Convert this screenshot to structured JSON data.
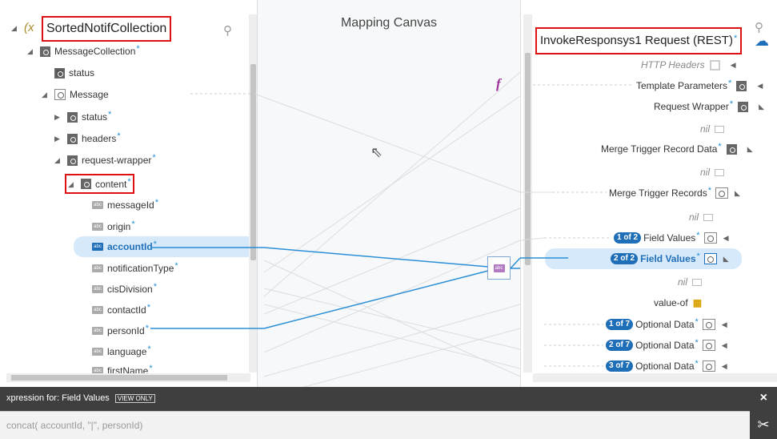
{
  "source": {
    "root_label": "SortedNotifCollection",
    "root_prefix": "(x",
    "items": [
      {
        "label": "MessageCollection"
      },
      {
        "label": "status"
      },
      {
        "label": "Message"
      },
      {
        "label": "status"
      },
      {
        "label": "headers"
      },
      {
        "label": "request-wrapper"
      },
      {
        "label": "content"
      },
      {
        "label": "messageId"
      },
      {
        "label": "origin"
      },
      {
        "label": "accountId"
      },
      {
        "label": "notificationType"
      },
      {
        "label": "cisDivision"
      },
      {
        "label": "contactId"
      },
      {
        "label": "personId"
      },
      {
        "label": "language"
      },
      {
        "label": "firstName"
      }
    ]
  },
  "canvas": {
    "title": "Mapping Canvas",
    "function_glyph": "f",
    "node_label": "abc"
  },
  "target": {
    "root_label": "InvokeResponsys1 Request (REST)",
    "items": [
      {
        "label": "HTTP Headers"
      },
      {
        "label": "Template Parameters"
      },
      {
        "label": "Request Wrapper"
      },
      {
        "label": "nil"
      },
      {
        "label": "Merge Trigger Record Data"
      },
      {
        "label": "nil"
      },
      {
        "label": "Merge Trigger Records"
      },
      {
        "label": "nil"
      },
      {
        "label": "Field Values",
        "badge": "1 of 2"
      },
      {
        "label": "Field Values",
        "badge": "2 of 2"
      },
      {
        "label": "nil"
      },
      {
        "label": "value-of"
      },
      {
        "label": "Optional Data",
        "badge": "1 of 7"
      },
      {
        "label": "Optional Data",
        "badge": "2 of 7"
      },
      {
        "label": "Optional Data",
        "badge": "3 of 7"
      }
    ]
  },
  "expression": {
    "prefix": "xpression for:",
    "field": "Field Values",
    "mode": "VIEW ONLY",
    "value": "concat( accountId, \"|\", personId)",
    "close": "×",
    "tools_glyph": "✂"
  },
  "colors": {
    "accent": "#1f6fb8",
    "required": "#2a8fd6",
    "highlight": "#d11111",
    "link": "#2a8fd6"
  }
}
